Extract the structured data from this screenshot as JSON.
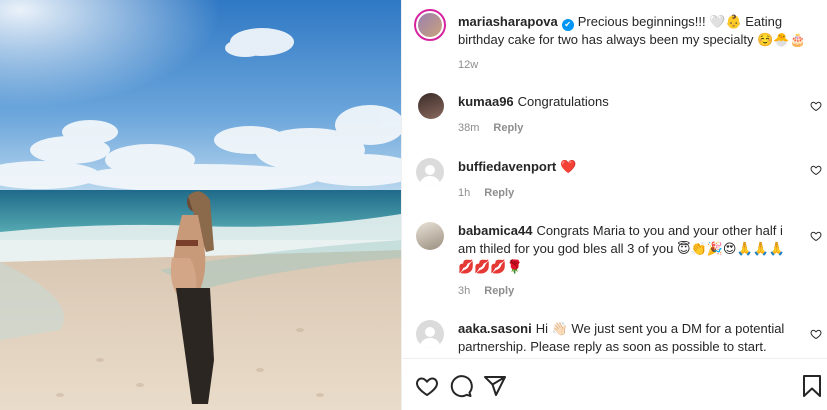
{
  "post": {
    "username": "mariasharapova",
    "caption": "Precious beginnings!!! 🤍👶 Eating birthday cake for two has always been my specialty ☺️🐣🎂",
    "time": "12w"
  },
  "comments": [
    {
      "username": "kumaa96",
      "text": "Congratulations",
      "time": "38m",
      "reply": "Reply"
    },
    {
      "username": "buffiedavenport",
      "text": "❤️",
      "time": "1h",
      "reply": "Reply"
    },
    {
      "username": "babamica44",
      "text": "Congrats Maria to you and your other half i am thiled for you god bles all 3 of you 😇👏🎉😍🙏🙏🙏💋💋💋🌹",
      "time": "3h",
      "reply": "Reply"
    },
    {
      "username": "aaka.sasoni",
      "text": "Hi 👋🏻 We just sent you a DM for a potential partnership. Please reply as soon as possible to start. Thank you😊",
      "time": "",
      "reply": ""
    }
  ],
  "icons": {
    "like": "heart-icon",
    "comment": "comment-icon",
    "share": "share-icon",
    "save": "bookmark-icon"
  },
  "colors": {
    "verified": "#0095f6",
    "meta_text": "#8e8e8e",
    "heart_red": "#ed4956"
  }
}
